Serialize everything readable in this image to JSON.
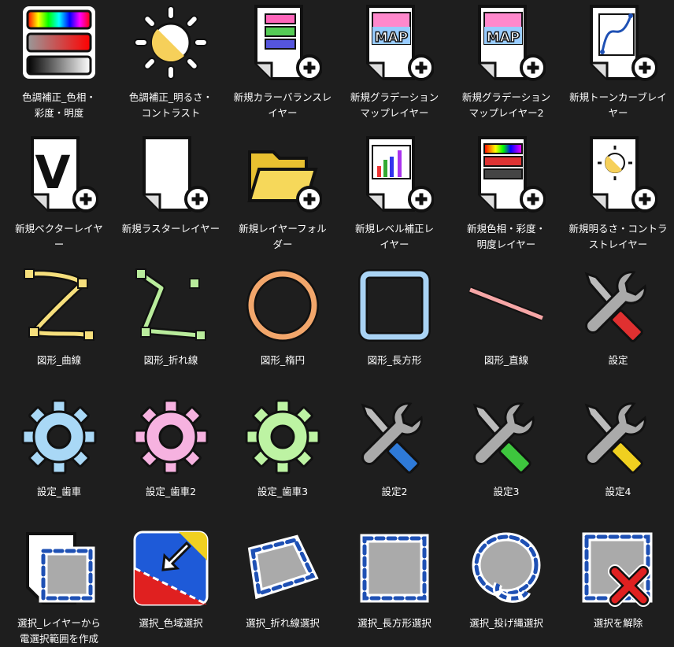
{
  "items": [
    {
      "id": "hue-sat",
      "label": "色調補正_色相・\n彩度・明度",
      "icon": "hue-saturation-icon"
    },
    {
      "id": "brightness",
      "label": "色調補正_明るさ・\nコントラスト",
      "icon": "sun-icon"
    },
    {
      "id": "color-balance",
      "label": "新規カラーバランスレ\nイヤー",
      "icon": "color-balance-layer-icon"
    },
    {
      "id": "gradient-map",
      "label": "新規グラデーション\nマップレイヤー",
      "icon": "gradient-map-layer-icon",
      "map_text": "MAP"
    },
    {
      "id": "gradient-map-2",
      "label": "新規グラデーション\nマップレイヤー2",
      "icon": "gradient-map-layer-icon",
      "map_text": "MAP"
    },
    {
      "id": "tone-curve",
      "label": "新規トーンカーブレイ\nヤー",
      "icon": "tone-curve-layer-icon"
    },
    {
      "id": "vector-layer",
      "label": "新規ベクターレイヤ\nー",
      "icon": "vector-layer-icon",
      "v_text": "V"
    },
    {
      "id": "raster-layer",
      "label": "新規ラスターレイヤー",
      "icon": "raster-layer-icon"
    },
    {
      "id": "layer-folder",
      "label": "新規レイヤーフォル\nダー",
      "icon": "folder-icon"
    },
    {
      "id": "levels-layer",
      "label": "新規レベル補正レ\nイヤー",
      "icon": "levels-layer-icon"
    },
    {
      "id": "hsl-layer",
      "label": "新規色相・彩度・\n明度レイヤー",
      "icon": "hsl-layer-icon"
    },
    {
      "id": "brightness-layer",
      "label": "新規明るさ・コントラ\nストレイヤー",
      "icon": "brightness-layer-icon"
    },
    {
      "id": "shape-curve",
      "label": "図形_曲線",
      "icon": "curve-shape-icon",
      "color": "#f6df7c"
    },
    {
      "id": "shape-polyline",
      "label": "図形_折れ線",
      "icon": "polyline-shape-icon",
      "color": "#b9ec9c"
    },
    {
      "id": "shape-ellipse",
      "label": "図形_楕円",
      "icon": "ellipse-shape-icon",
      "color": "#f2a66b"
    },
    {
      "id": "shape-rect",
      "label": "図形_長方形",
      "icon": "rectangle-shape-icon",
      "color": "#a9d3f4"
    },
    {
      "id": "shape-line",
      "label": "図形_直線",
      "icon": "line-shape-icon",
      "color": "#f6a6a6"
    },
    {
      "id": "settings",
      "label": "設定",
      "icon": "wrench-screwdriver-icon",
      "color": "#e03030"
    },
    {
      "id": "settings-gear",
      "label": "設定_歯車",
      "icon": "gear-icon",
      "color": "#a9d8f6"
    },
    {
      "id": "settings-gear-2",
      "label": "設定_歯車2",
      "icon": "gear-icon",
      "color": "#f6b2e0"
    },
    {
      "id": "settings-gear-3",
      "label": "設定_歯車3",
      "icon": "gear-icon",
      "color": "#bdf3a3"
    },
    {
      "id": "settings-2",
      "label": "設定2",
      "icon": "wrench-screwdriver-icon",
      "color": "#2e7ad8"
    },
    {
      "id": "settings-3",
      "label": "設定3",
      "icon": "wrench-screwdriver-icon",
      "color": "#3ec63e"
    },
    {
      "id": "settings-4",
      "label": "設定4",
      "icon": "wrench-screwdriver-icon",
      "color": "#f0d020"
    },
    {
      "id": "sel-from-layer",
      "label": "選択_レイヤーから\n電選択範囲を作成",
      "icon": "selection-from-layer-icon"
    },
    {
      "id": "sel-color",
      "label": "選択_色域選択",
      "icon": "color-range-select-icon"
    },
    {
      "id": "sel-polyline",
      "label": "選択_折れ線選択",
      "icon": "polyline-select-icon"
    },
    {
      "id": "sel-rect",
      "label": "選択_長方形選択",
      "icon": "rect-select-icon"
    },
    {
      "id": "sel-lasso",
      "label": "選択_投げ縄選択",
      "icon": "lasso-select-icon"
    },
    {
      "id": "sel-clear",
      "label": "選択を解除",
      "icon": "deselect-icon"
    }
  ]
}
